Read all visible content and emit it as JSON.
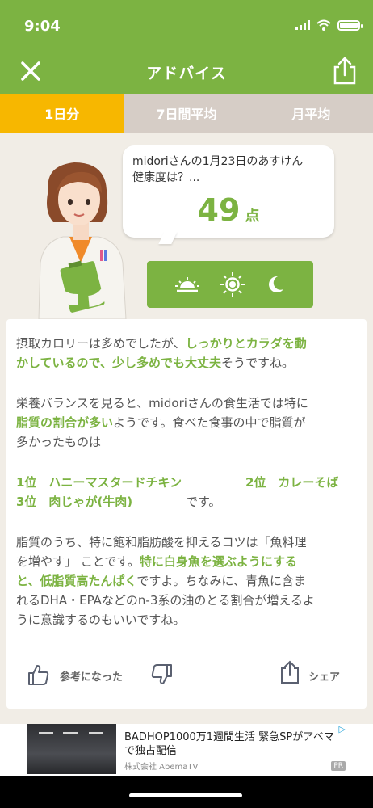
{
  "status": {
    "time": "9:04"
  },
  "header": {
    "title": "アドバイス"
  },
  "tabs": [
    {
      "label": "1日分",
      "active": true
    },
    {
      "label": "7日間平均",
      "active": false
    },
    {
      "label": "月平均",
      "active": false
    }
  ],
  "bubble": {
    "question_line1": "midoriさんの1月23日のあすけん",
    "question_line2": "健康度は？...",
    "score": "49",
    "unit": "点"
  },
  "advice": {
    "p1_plain1": "摂取カロリーは多めでしたが、",
    "p1_hl1": "しっかりとカラダを動",
    "p1_hl2": "かしているので、少し多めでも大丈夫",
    "p1_plain2": "そうですね。",
    "p2_line1": "栄養バランスを見ると、midoriさんの食生活では特に",
    "p2_hl": "脂質の割合が多い",
    "p2_plain": "ようです。食べた食事の中で脂質が",
    "p2_line3": "多かったものは",
    "rank1": "1位　ハニーマスタードチキン",
    "rank2": "2位　カレーそば",
    "rank3": "3位　肉じゃが(牛肉)",
    "rank_tail": "です。",
    "p3_line1": "脂質のうち、特に飽和脂肪酸を抑えるコツは「魚料理",
    "p3_line2_plain": "を増やす」 ことです。",
    "p3_line2_hl": "特に白身魚を選ぶようにする",
    "p3_line3_hl": "と、低脂質高たんぱく",
    "p3_line3_plain": "ですよ。ちなみに、青魚に含ま",
    "p3_line4": "れるDHA・EPAなどのn-3系の油のとる割合が増えるよ",
    "p3_line5": "うに意識するのもいいですね。"
  },
  "actions": {
    "helpful_label": "参考になった",
    "share_label": "シェア"
  },
  "ad": {
    "title": "BADHOP1000万1週間生活 緊急SPがアベマで独占配信",
    "sponsor": "株式会社 AbemaTV",
    "pr_badge": "PR"
  },
  "colors": {
    "green": "#7cb342",
    "active_tab": "#f7b700",
    "inactive_tab": "#d6cdc6",
    "background": "#f1ede6"
  }
}
